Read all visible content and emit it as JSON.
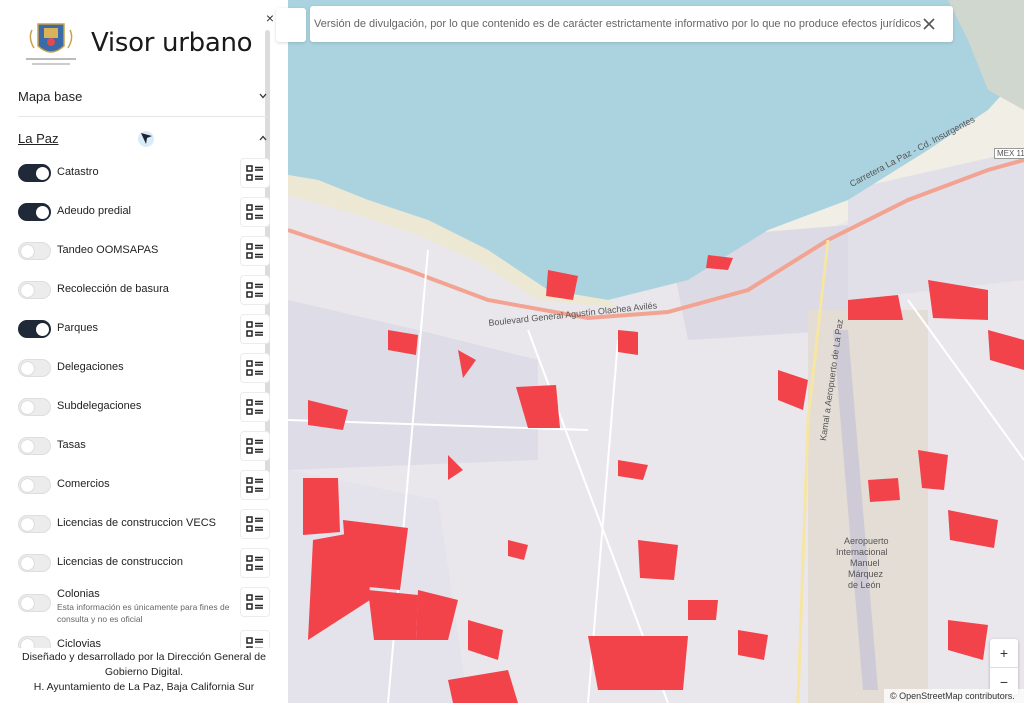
{
  "sidebar": {
    "title": "Visor urbano",
    "close_label": "×",
    "sections": {
      "mapa_base": "Mapa base",
      "la_paz": "La Paz"
    },
    "layers": [
      {
        "name": "Catastro",
        "on": true
      },
      {
        "name": "Adeudo predial",
        "on": true
      },
      {
        "name": "Tandeo OOMSAPAS",
        "on": false
      },
      {
        "name": "Recolección de basura",
        "on": false
      },
      {
        "name": "Parques",
        "on": true
      },
      {
        "name": "Delegaciones",
        "on": false
      },
      {
        "name": "Subdelegaciones",
        "on": false
      },
      {
        "name": "Tasas",
        "on": false
      },
      {
        "name": "Comercios",
        "on": false
      },
      {
        "name": "Licencias de construccion VECS",
        "on": false
      },
      {
        "name": "Licencias de construccion",
        "on": false
      },
      {
        "name": "Colonias",
        "on": false,
        "note": "Esta información es únicamente para fines de consulta y no es oficial"
      },
      {
        "name": "Ciclovias",
        "on": false
      }
    ],
    "footer": {
      "line1": "Diseñado y desarrollado por la Dirección General de",
      "line2": "Gobierno Digital.",
      "line3": "H. Ayuntamiento de La Paz, Baja California Sur"
    }
  },
  "banner": {
    "text": "Versión de divulgación, por lo que contenido es de carácter estrictamente informativo por lo que no produce efectos jurídicos"
  },
  "map": {
    "zoom_in": "+",
    "zoom_out": "−",
    "attribution": "© OpenStreetMap contributors.",
    "labels": {
      "airport_1": "Aeropuerto",
      "airport_2": "Internacional",
      "airport_3": "Manuel",
      "airport_4": "Márquez",
      "airport_5": "de León",
      "road_1": "Carretera La Paz - Cd. Insurgentes",
      "road_2": "Kamal a Aeropuerto de La Paz",
      "road_3": "Boulevard General Agustín Olachea Avilés",
      "shield": "MEX 11"
    },
    "colors": {
      "water": "#aad3df",
      "land": "#f1eee6",
      "parcel": "#f2434b",
      "road": "#f2a391",
      "urban": "#dfdde6"
    }
  }
}
